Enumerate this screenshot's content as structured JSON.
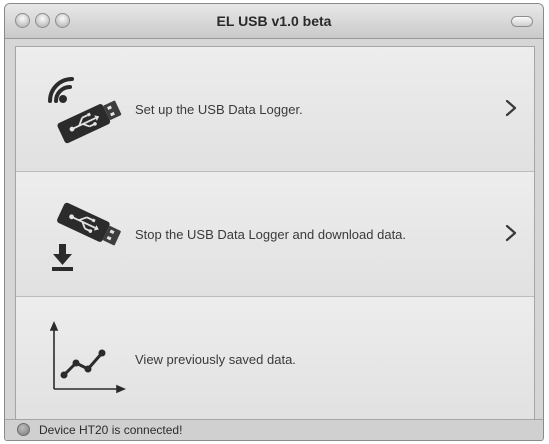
{
  "window": {
    "title": "EL USB v1.0 beta"
  },
  "actions": [
    {
      "label": "Set up the USB Data Logger.",
      "icon": "usb-wireless-icon"
    },
    {
      "label": "Stop the USB Data Logger and download data.",
      "icon": "usb-download-icon"
    },
    {
      "label": "View previously saved data.",
      "icon": "line-chart-icon"
    }
  ],
  "status": {
    "text": "Device HT20 is connected!"
  }
}
